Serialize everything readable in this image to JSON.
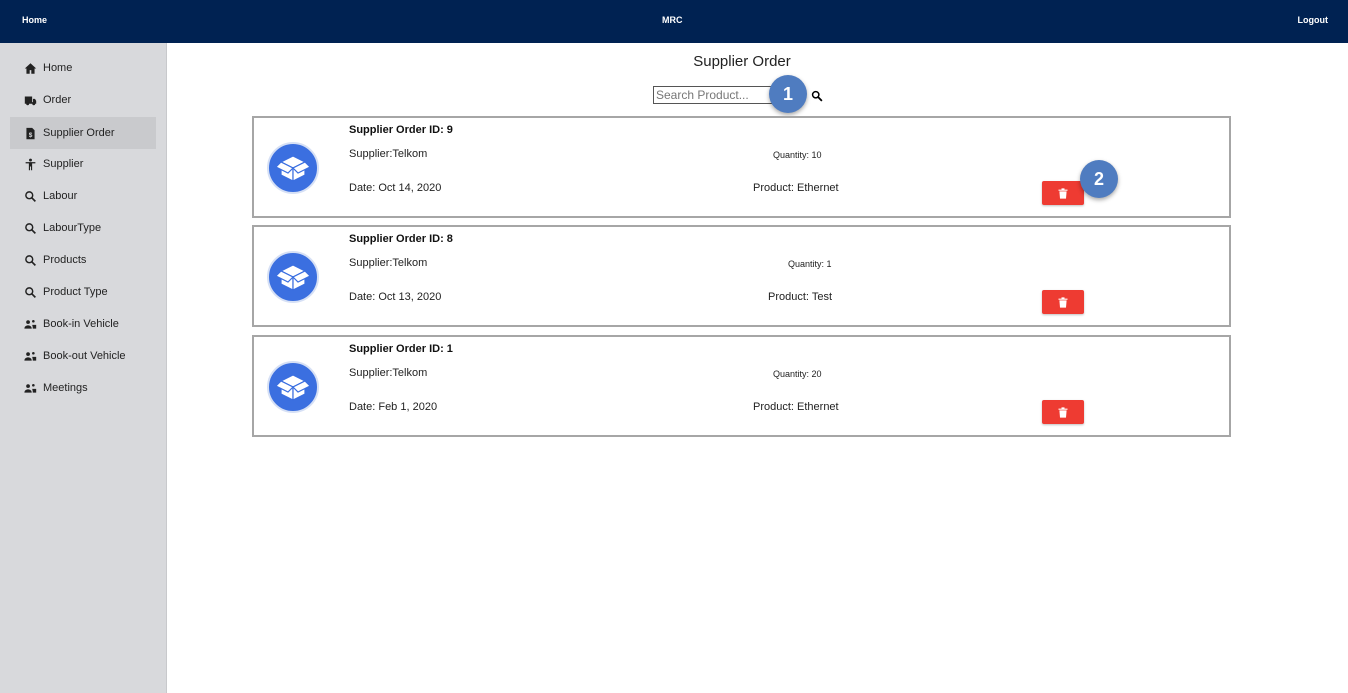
{
  "topbar": {
    "home": "Home",
    "brand": "MRC",
    "logout": "Logout"
  },
  "sidebar": {
    "items": [
      {
        "label": "Home",
        "icon": "home-icon"
      },
      {
        "label": "Order",
        "icon": "truck-icon"
      },
      {
        "label": "Supplier Order",
        "icon": "money-file-icon",
        "active": true
      },
      {
        "label": "Supplier",
        "icon": "person-icon"
      },
      {
        "label": "Labour",
        "icon": "search-icon"
      },
      {
        "label": "LabourType",
        "icon": "search-icon"
      },
      {
        "label": "Products",
        "icon": "search-icon"
      },
      {
        "label": "Product Type",
        "icon": "search-icon"
      },
      {
        "label": "Book-in Vehicle",
        "icon": "people-icon"
      },
      {
        "label": "Book-out Vehicle",
        "icon": "people-icon"
      },
      {
        "label": "Meetings",
        "icon": "people-icon"
      }
    ]
  },
  "main": {
    "title": "Supplier Order",
    "search": {
      "placeholder": "Search Product...",
      "value": ""
    },
    "markers": [
      "1",
      "2"
    ],
    "orders": [
      {
        "id_label": "Supplier Order ID: 9",
        "supplier": "Supplier:Telkom",
        "date": "Date: Oct 14, 2020",
        "quantity": "Quantity: 10",
        "product": "Product: Ethernet"
      },
      {
        "id_label": "Supplier Order ID: 8",
        "supplier": "Supplier:Telkom",
        "date": "Date: Oct 13, 2020",
        "quantity": "Quantity: 1",
        "product": "Product: Test"
      },
      {
        "id_label": "Supplier Order ID: 1",
        "supplier": "Supplier:Telkom",
        "date": "Date: Feb 1, 2020",
        "quantity": "Quantity: 20",
        "product": "Product: Ethernet"
      }
    ]
  },
  "colors": {
    "topbar": "#002252",
    "sidebar": "#d8d9dc",
    "delete": "#ee3b32",
    "avatar": "#3b6fe0",
    "marker": "#4f7cc0"
  }
}
